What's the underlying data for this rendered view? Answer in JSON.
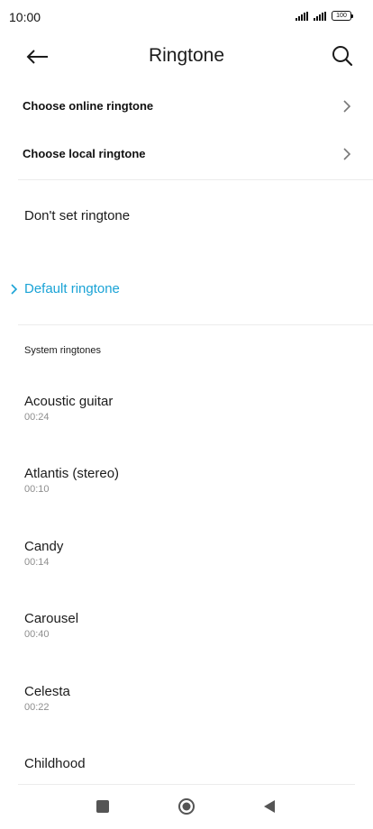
{
  "status_bar": {
    "time": "10:00",
    "battery": "100"
  },
  "header": {
    "title": "Ringtone"
  },
  "options": {
    "online": "Choose online ringtone",
    "local": "Choose local ringtone",
    "none": "Don't set ringtone",
    "default": "Default ringtone"
  },
  "section": {
    "label": "System ringtones"
  },
  "ringtones": [
    {
      "name": "Acoustic guitar",
      "duration": "00:24"
    },
    {
      "name": "Atlantis (stereo)",
      "duration": "00:10"
    },
    {
      "name": "Candy",
      "duration": "00:14"
    },
    {
      "name": "Carousel",
      "duration": "00:40"
    },
    {
      "name": "Celesta",
      "duration": "00:22"
    },
    {
      "name": "Childhood",
      "duration": ""
    }
  ],
  "colors": {
    "accent": "#1aa3d6",
    "text": "#1b1b1b",
    "secondary": "#8e8e8e"
  }
}
